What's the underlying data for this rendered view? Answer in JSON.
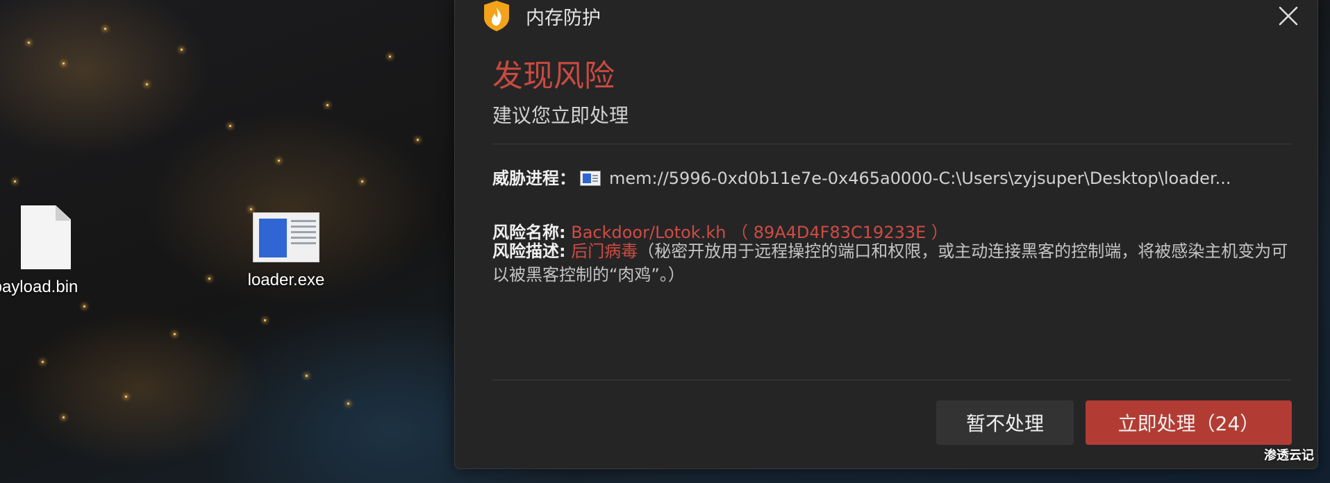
{
  "desktop": {
    "icons": [
      {
        "label": "payload.bin",
        "icon": "document-file-icon"
      },
      {
        "label": "loader.exe",
        "icon": "application-exe-icon"
      }
    ]
  },
  "dialog": {
    "header_title": "内存防护",
    "header_icon": "shield-flame-icon",
    "close_icon": "close-icon",
    "alert_title": "发现风险",
    "alert_subtitle": "建议您立即处理",
    "process_label": "威胁进程：",
    "process_value": "mem://5996-0xd0b11e7e-0x465a0000-C:\\Users\\zyjsuper\\Desktop\\loader...",
    "risk_name_label": "风险名称:",
    "risk_name_value": "Backdoor/Lotok.kh",
    "risk_hash": "（ 89A4D4F83C19233E ）",
    "risk_desc_label": "风险描述:",
    "risk_desc_type": "后门病毒",
    "risk_desc_text": "（秘密开放用于远程操控的端口和权限，或主动连接黑客的控制端，将被感染主机变为可以被黑客控制的“肉鸡”。）",
    "btn_ignore": "暂不处理",
    "btn_handle": "立即处理（24）"
  },
  "colors": {
    "alert_red": "#c94a40",
    "button_red": "#b23c33",
    "dialog_bg": "#252526",
    "shield_orange": "#f2a31a"
  },
  "watermark": "渗透云记"
}
